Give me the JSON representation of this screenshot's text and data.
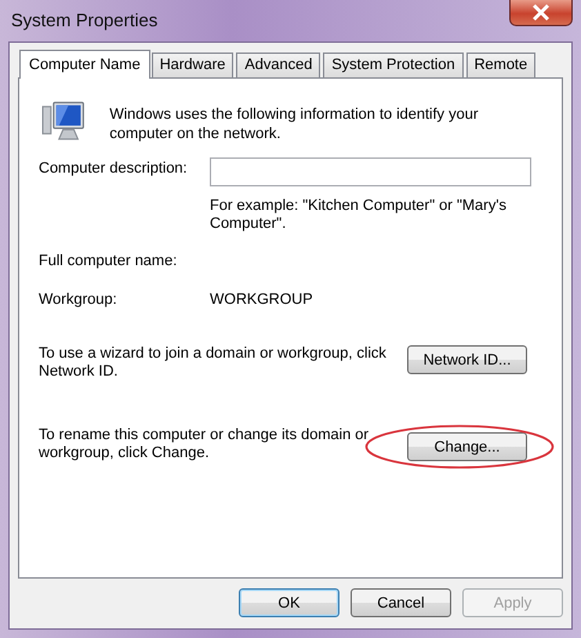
{
  "window": {
    "title": "System Properties"
  },
  "tabs": [
    {
      "label": "Computer Name",
      "selected": true
    },
    {
      "label": "Hardware",
      "selected": false
    },
    {
      "label": "Advanced",
      "selected": false
    },
    {
      "label": "System Protection",
      "selected": false
    },
    {
      "label": "Remote",
      "selected": false
    }
  ],
  "intro": "Windows uses the following information to identify your computer on the network.",
  "description": {
    "label": "Computer description:",
    "hint": "For example: \"Kitchen Computer\" or \"Mary's Computer\"."
  },
  "full_name": {
    "label": "Full computer name:"
  },
  "workgroup": {
    "label": "Workgroup:",
    "value": "WORKGROUP"
  },
  "actions": [
    {
      "text": "To use a wizard to join a domain or workgroup, click Network ID.",
      "button": "Network ID...",
      "circled": false
    },
    {
      "text": "To rename this computer or change its domain or workgroup, click Change.",
      "button": "Change...",
      "circled": true
    }
  ],
  "buttons": [
    {
      "label": "OK",
      "default": true,
      "disabled": false
    },
    {
      "label": "Cancel",
      "default": false,
      "disabled": false
    },
    {
      "label": "Apply",
      "default": false,
      "disabled": true
    }
  ]
}
